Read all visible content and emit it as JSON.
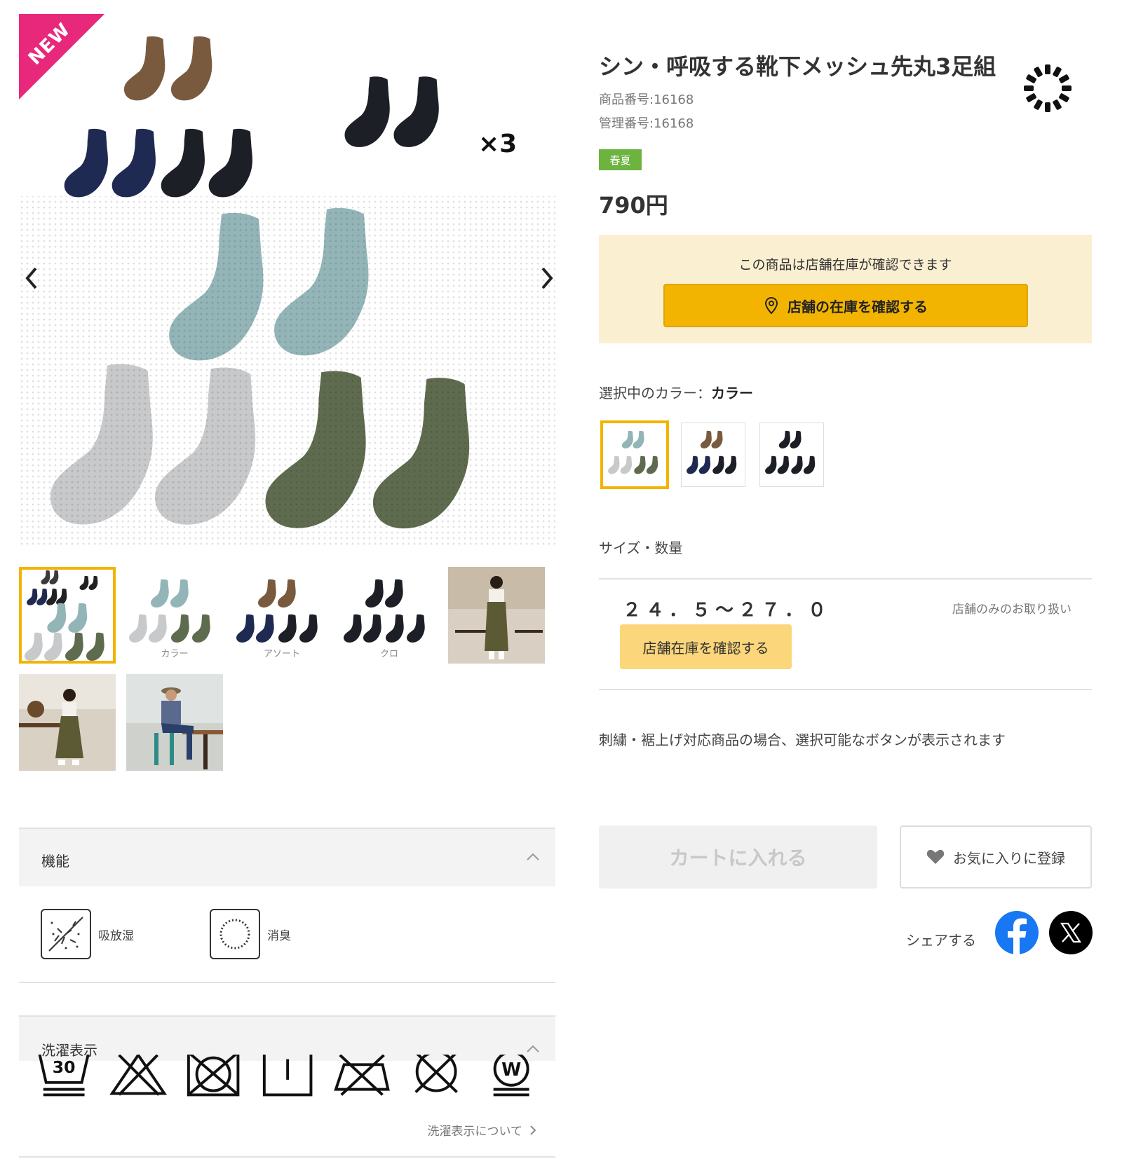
{
  "gallery": {
    "ribbon": "NEW",
    "times_label": "×3",
    "thumbnails": [
      {
        "caption": ""
      },
      {
        "caption": "カラー"
      },
      {
        "caption": "アソート"
      },
      {
        "caption": "クロ"
      },
      {
        "caption": ""
      },
      {
        "caption": ""
      },
      {
        "caption": ""
      }
    ]
  },
  "features": {
    "title": "機能",
    "items": [
      {
        "label": "吸放湿",
        "icon": "moisture-wicking-icon"
      },
      {
        "label": "消臭",
        "icon": "deodorizing-icon"
      }
    ]
  },
  "washing": {
    "title": "洗濯表示",
    "icon_30": "30",
    "icon_w": "W",
    "about_link": "洗濯表示について"
  },
  "product": {
    "title": "シン・呼吸する靴下メッシュ先丸3足組",
    "product_number": "商品番号:16168",
    "management_number": "管理番号:16168",
    "season": "春夏",
    "price": "790円"
  },
  "store_stock": {
    "note": "この商品は店舗在庫が確認できます",
    "button_label": "店舗の在庫を確認する"
  },
  "color": {
    "label_prefix": "選択中のカラー：",
    "selected": "カラー"
  },
  "size": {
    "label": "サイズ・数量",
    "value": "２４．５～２７．０",
    "note": "店舗のみのお取り扱い",
    "button_label": "店舗在庫を確認する"
  },
  "embroidery_note": "刺繍・裾上げ対応商品の場合、選択可能なボタンが表示されます",
  "actions": {
    "cart_label": "カートに入れる",
    "favorite_label": "お気に入りに登録"
  },
  "share": {
    "label": "シェアする"
  },
  "colors": {
    "accent": "#f2b400",
    "new_ribbon": "#e8287a",
    "season_badge": "#6db33f",
    "facebook": "#1877f2",
    "x": "#000000"
  }
}
